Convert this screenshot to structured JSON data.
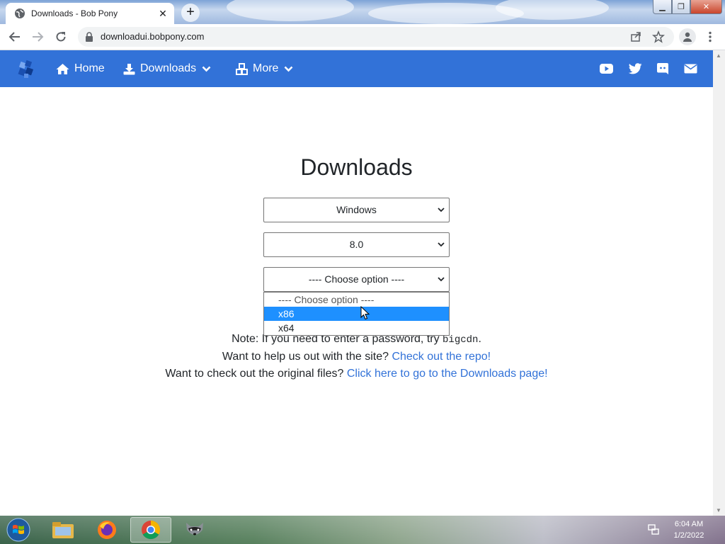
{
  "browser": {
    "tab_title": "Downloads - Bob Pony",
    "tab_close_glyph": "✕",
    "new_tab_glyph": "+",
    "url": "downloadui.bobpony.com",
    "window_buttons": {
      "minimize": "▁",
      "maximize": "❐",
      "close": "✕"
    }
  },
  "nav": {
    "home_label": "Home",
    "downloads_label": "Downloads",
    "more_label": "More",
    "brand_color": "#3272d8",
    "social_icons": [
      "youtube-icon",
      "twitter-icon",
      "discord-icon",
      "envelope-icon"
    ]
  },
  "main": {
    "title": "Downloads",
    "os_select": {
      "value": "Windows"
    },
    "version_select": {
      "value": "8.0"
    },
    "arch_select": {
      "value": "---- Choose option ----",
      "options": [
        "---- Choose option ----",
        "x86",
        "x64"
      ],
      "highlighted": "x86"
    },
    "note_prefix": "Note: If you need to enter a password, try ",
    "note_code": "bigcdn",
    "note_suffix": ".",
    "help_text": "Want to help us out with the site? ",
    "help_link": "Check out the repo!",
    "original_text": "Want to check out the original files? ",
    "original_link": "Click here to go to the Downloads page!"
  },
  "taskbar": {
    "apps": [
      "file-explorer-icon",
      "firefox-icon",
      "chrome-icon",
      "raccoon-app-icon"
    ],
    "time": "6:04 AM",
    "date": "1/2/2022"
  }
}
